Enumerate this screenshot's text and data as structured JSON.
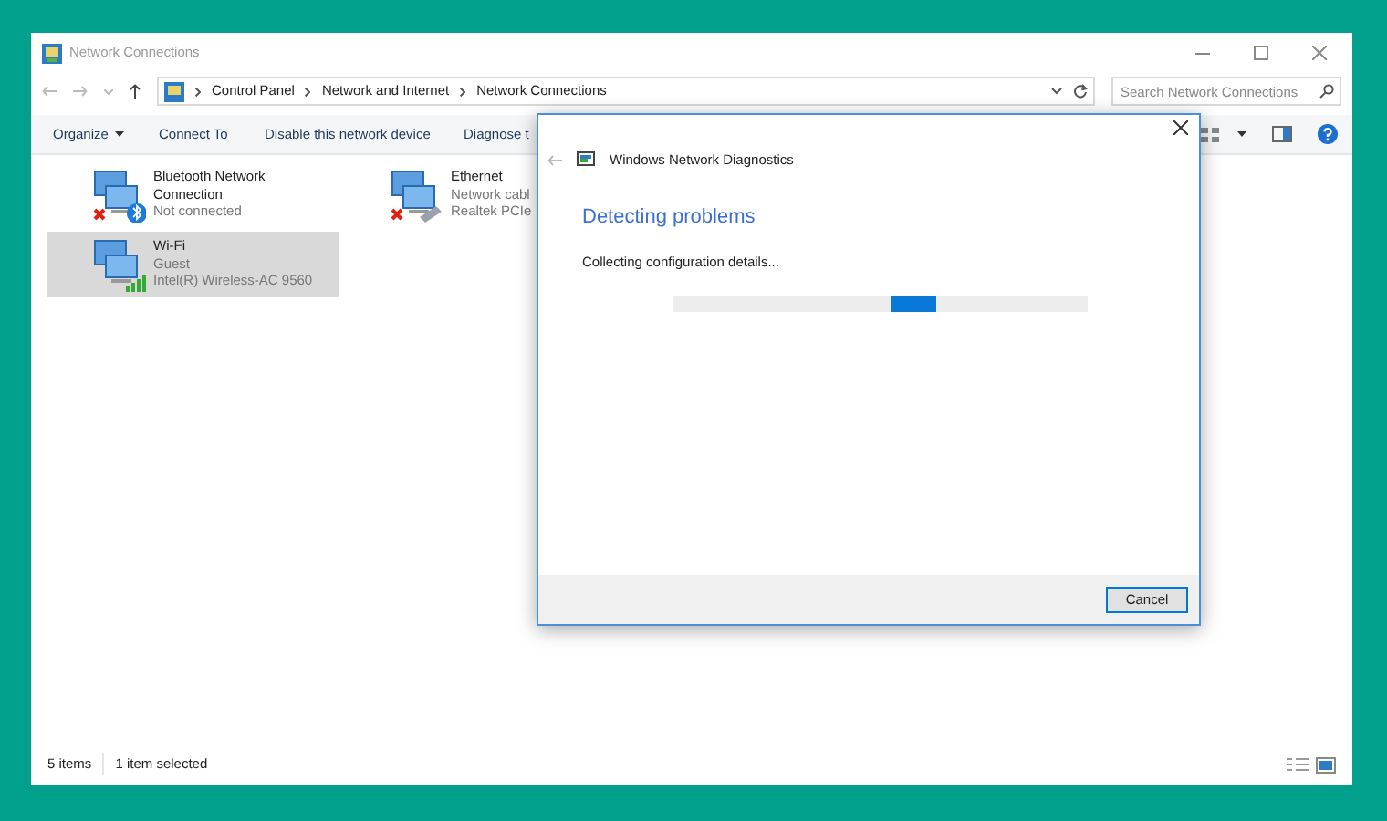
{
  "window": {
    "title": "Network Connections"
  },
  "breadcrumb": [
    "Control Panel",
    "Network and Internet",
    "Network Connections"
  ],
  "search": {
    "placeholder": "Search Network Connections"
  },
  "toolbar": [
    {
      "label": "Organize",
      "dropdown": true
    },
    {
      "label": "Connect To",
      "dropdown": false
    },
    {
      "label": "Disable this network device",
      "dropdown": false
    },
    {
      "label": "Diagnose t",
      "dropdown": false
    }
  ],
  "adapters": [
    {
      "kind": "bluetooth",
      "name": "Bluetooth Network Connection",
      "lines": [
        "Not connected"
      ],
      "error": true,
      "selected": false
    },
    {
      "kind": "ethernet",
      "name": "Ethernet",
      "lines": [
        "Network cabl",
        "Realtek PCIe"
      ],
      "error": true,
      "selected": false
    },
    {
      "kind": "wifi",
      "name": "Wi-Fi",
      "lines": [
        "Guest",
        "Intel(R) Wireless-AC 9560"
      ],
      "error": false,
      "selected": true
    }
  ],
  "status_bar": {
    "count": "5 items",
    "selection": "1 item selected"
  },
  "dialog": {
    "title": "Windows Network Diagnostics",
    "heading": "Detecting problems",
    "message": "Collecting configuration details...",
    "progress": {
      "indeterminate": true
    },
    "buttons": [
      "Cancel"
    ]
  }
}
